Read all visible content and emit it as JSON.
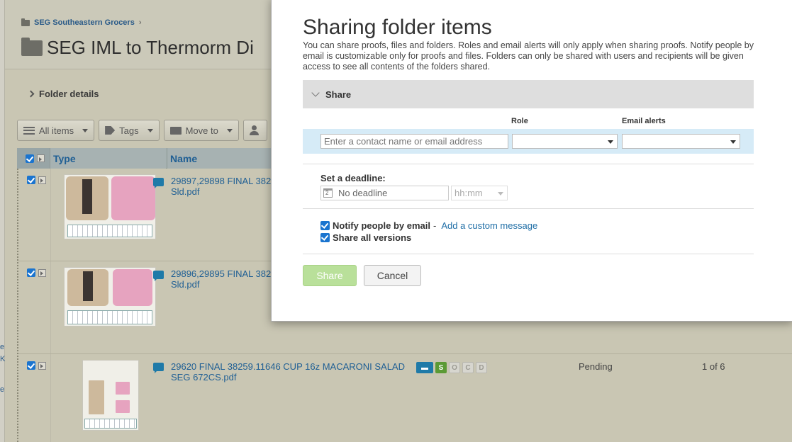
{
  "background": {
    "left_fragments": [
      "e",
      "K",
      "e"
    ],
    "breadcrumb": {
      "label": "SEG Southeastern Grocers",
      "separator": "›"
    },
    "page_title": "SEG IML to Thermorm Di",
    "folder_details": "Folder details",
    "toolbar": {
      "all_items": "All items",
      "tags": "Tags",
      "move_to": "Move to"
    },
    "columns": {
      "type": "Type",
      "name": "Name"
    },
    "rows": [
      {
        "name": "29897,29898 FINAL 382\nSld.pdf"
      },
      {
        "name": "29896,29895 FINAL 382\nSld.pdf"
      },
      {
        "name": "29620 FINAL 38259.11646 CUP 16z MACARONI SALAD\nSEG 672CS.pdf",
        "badge_s": "S",
        "badge_o": "O",
        "badge_c": "C",
        "badge_d": "D",
        "status": "Pending",
        "version": "1 of 6"
      }
    ]
  },
  "modal": {
    "title": "Sharing folder items",
    "description": "You can share proofs, files and folders. Roles and email alerts will only apply when sharing proofs. Notify people by email is customizable only for proofs and files. Folders can only be shared with users and recipients will be given access to see all contents of the folders shared.",
    "section_label": "Share",
    "role_label": "Role",
    "email_alerts_label": "Email alerts",
    "contact_placeholder": "Enter a contact name or email address",
    "deadline_label": "Set a deadline:",
    "deadline_value": "No deadline",
    "time_placeholder": "hh:mm",
    "notify_label": "Notify people by email",
    "notify_sep": "-",
    "custom_message_link": "Add a custom message",
    "share_versions_label": "Share all versions",
    "share_button": "Share",
    "cancel_button": "Cancel",
    "colors": {
      "accent": "#1f6ea6",
      "share_button": "#b9e09a",
      "contact_row": "#d6ebf7"
    }
  }
}
